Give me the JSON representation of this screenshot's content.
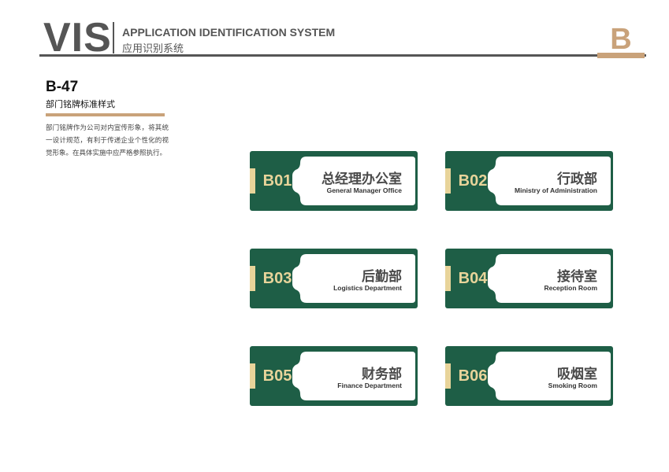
{
  "header": {
    "logo": "VIS",
    "title": "APPLICATION IDENTIFICATION SYSTEM",
    "subtitle": "应用识别系统",
    "section_letter": "B"
  },
  "section": {
    "code": "B-47",
    "title": "部门铭牌标准样式",
    "description": "部门铭牌作为公司对内宣传形象，将其统一设计规范，有利于传递企业个性化的视觉形象。在具体实施中应严格参照执行。"
  },
  "colors": {
    "plate_green": "#1e5e46",
    "accent_gold": "#c9a27a",
    "code_cream": "#e8d49a"
  },
  "plates": [
    {
      "code": "B01",
      "name_cn": "总经理办公室",
      "name_en": "General Manager Office"
    },
    {
      "code": "B02",
      "name_cn": "行政部",
      "name_en": "Ministry of Administration"
    },
    {
      "code": "B03",
      "name_cn": "后勤部",
      "name_en": "Logistics Department"
    },
    {
      "code": "B04",
      "name_cn": "接待室",
      "name_en": "Reception Room"
    },
    {
      "code": "B05",
      "name_cn": "财务部",
      "name_en": "Finance Department"
    },
    {
      "code": "B06",
      "name_cn": "吸烟室",
      "name_en": "Smoking Room"
    }
  ]
}
